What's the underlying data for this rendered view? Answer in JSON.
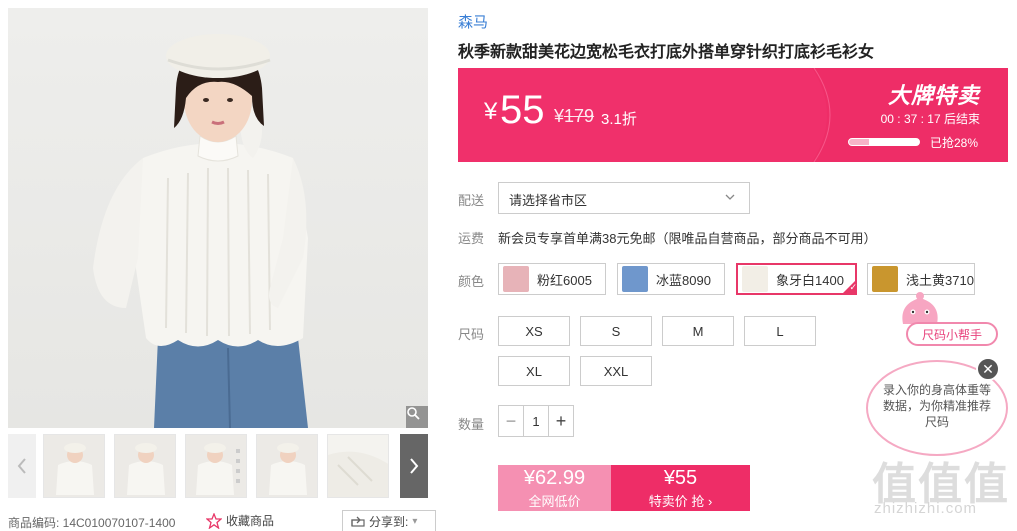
{
  "gallery": {
    "main_image": "product-photo-woman-ivory-sweater",
    "thumbnails": [
      "thumb-1",
      "thumb-2",
      "thumb-3",
      "thumb-4",
      "thumb-5"
    ],
    "sku_label": "商品编码: 14C010070107-1400",
    "favorite_label": "收藏商品",
    "share_label": "分享到:"
  },
  "product": {
    "brand": "森马",
    "title": "秋季新款甜美花边宽松毛衣打底外搭单穿针织打底衫毛衫女"
  },
  "price_banner": {
    "currency": "¥",
    "price": "55",
    "original_price": "179",
    "original_currency": "¥",
    "discount": "3.1折",
    "sale_title": "大牌特卖",
    "countdown": "00 : 37 : 17  后结束",
    "progress_percent": 28,
    "progress_label": "已抢28%",
    "colors": {
      "accent": "#f0306b",
      "panel": "#ee2d67"
    }
  },
  "delivery": {
    "label": "配送",
    "select_value": "请选择省市区"
  },
  "shipping": {
    "label": "运费",
    "text": "新会员专享首单满38元免邮（限唯品自营商品，部分商品不可用）"
  },
  "colors": {
    "label": "颜色",
    "options": [
      {
        "label": "粉红6005",
        "swatch": "#e7b3b8",
        "selected": false
      },
      {
        "label": "冰蓝8090",
        "swatch": "#6f97cc",
        "selected": false
      },
      {
        "label": "象牙白1400",
        "swatch": "#f2eee6",
        "selected": true
      },
      {
        "label": "浅土黄3710",
        "swatch": "#c9962e",
        "selected": false
      }
    ]
  },
  "sizes": {
    "label": "尺码",
    "options": [
      "XS",
      "S",
      "M",
      "L",
      "XL",
      "XXL"
    ]
  },
  "quantity": {
    "label": "数量",
    "value": "1",
    "minus": "−",
    "plus": "+"
  },
  "buy": {
    "all_price": "¥62.99",
    "all_label": "全网低价",
    "special_price": "¥55",
    "special_label": "特卖价 抢 ›"
  },
  "size_helper": {
    "label": "尺码小帮手",
    "bubble_text": "录入你的身高体重等数据，为你精准推荐尺码",
    "close": "✕"
  },
  "watermark": {
    "logo": "值值值",
    "url": "zhizhizhi.com"
  }
}
